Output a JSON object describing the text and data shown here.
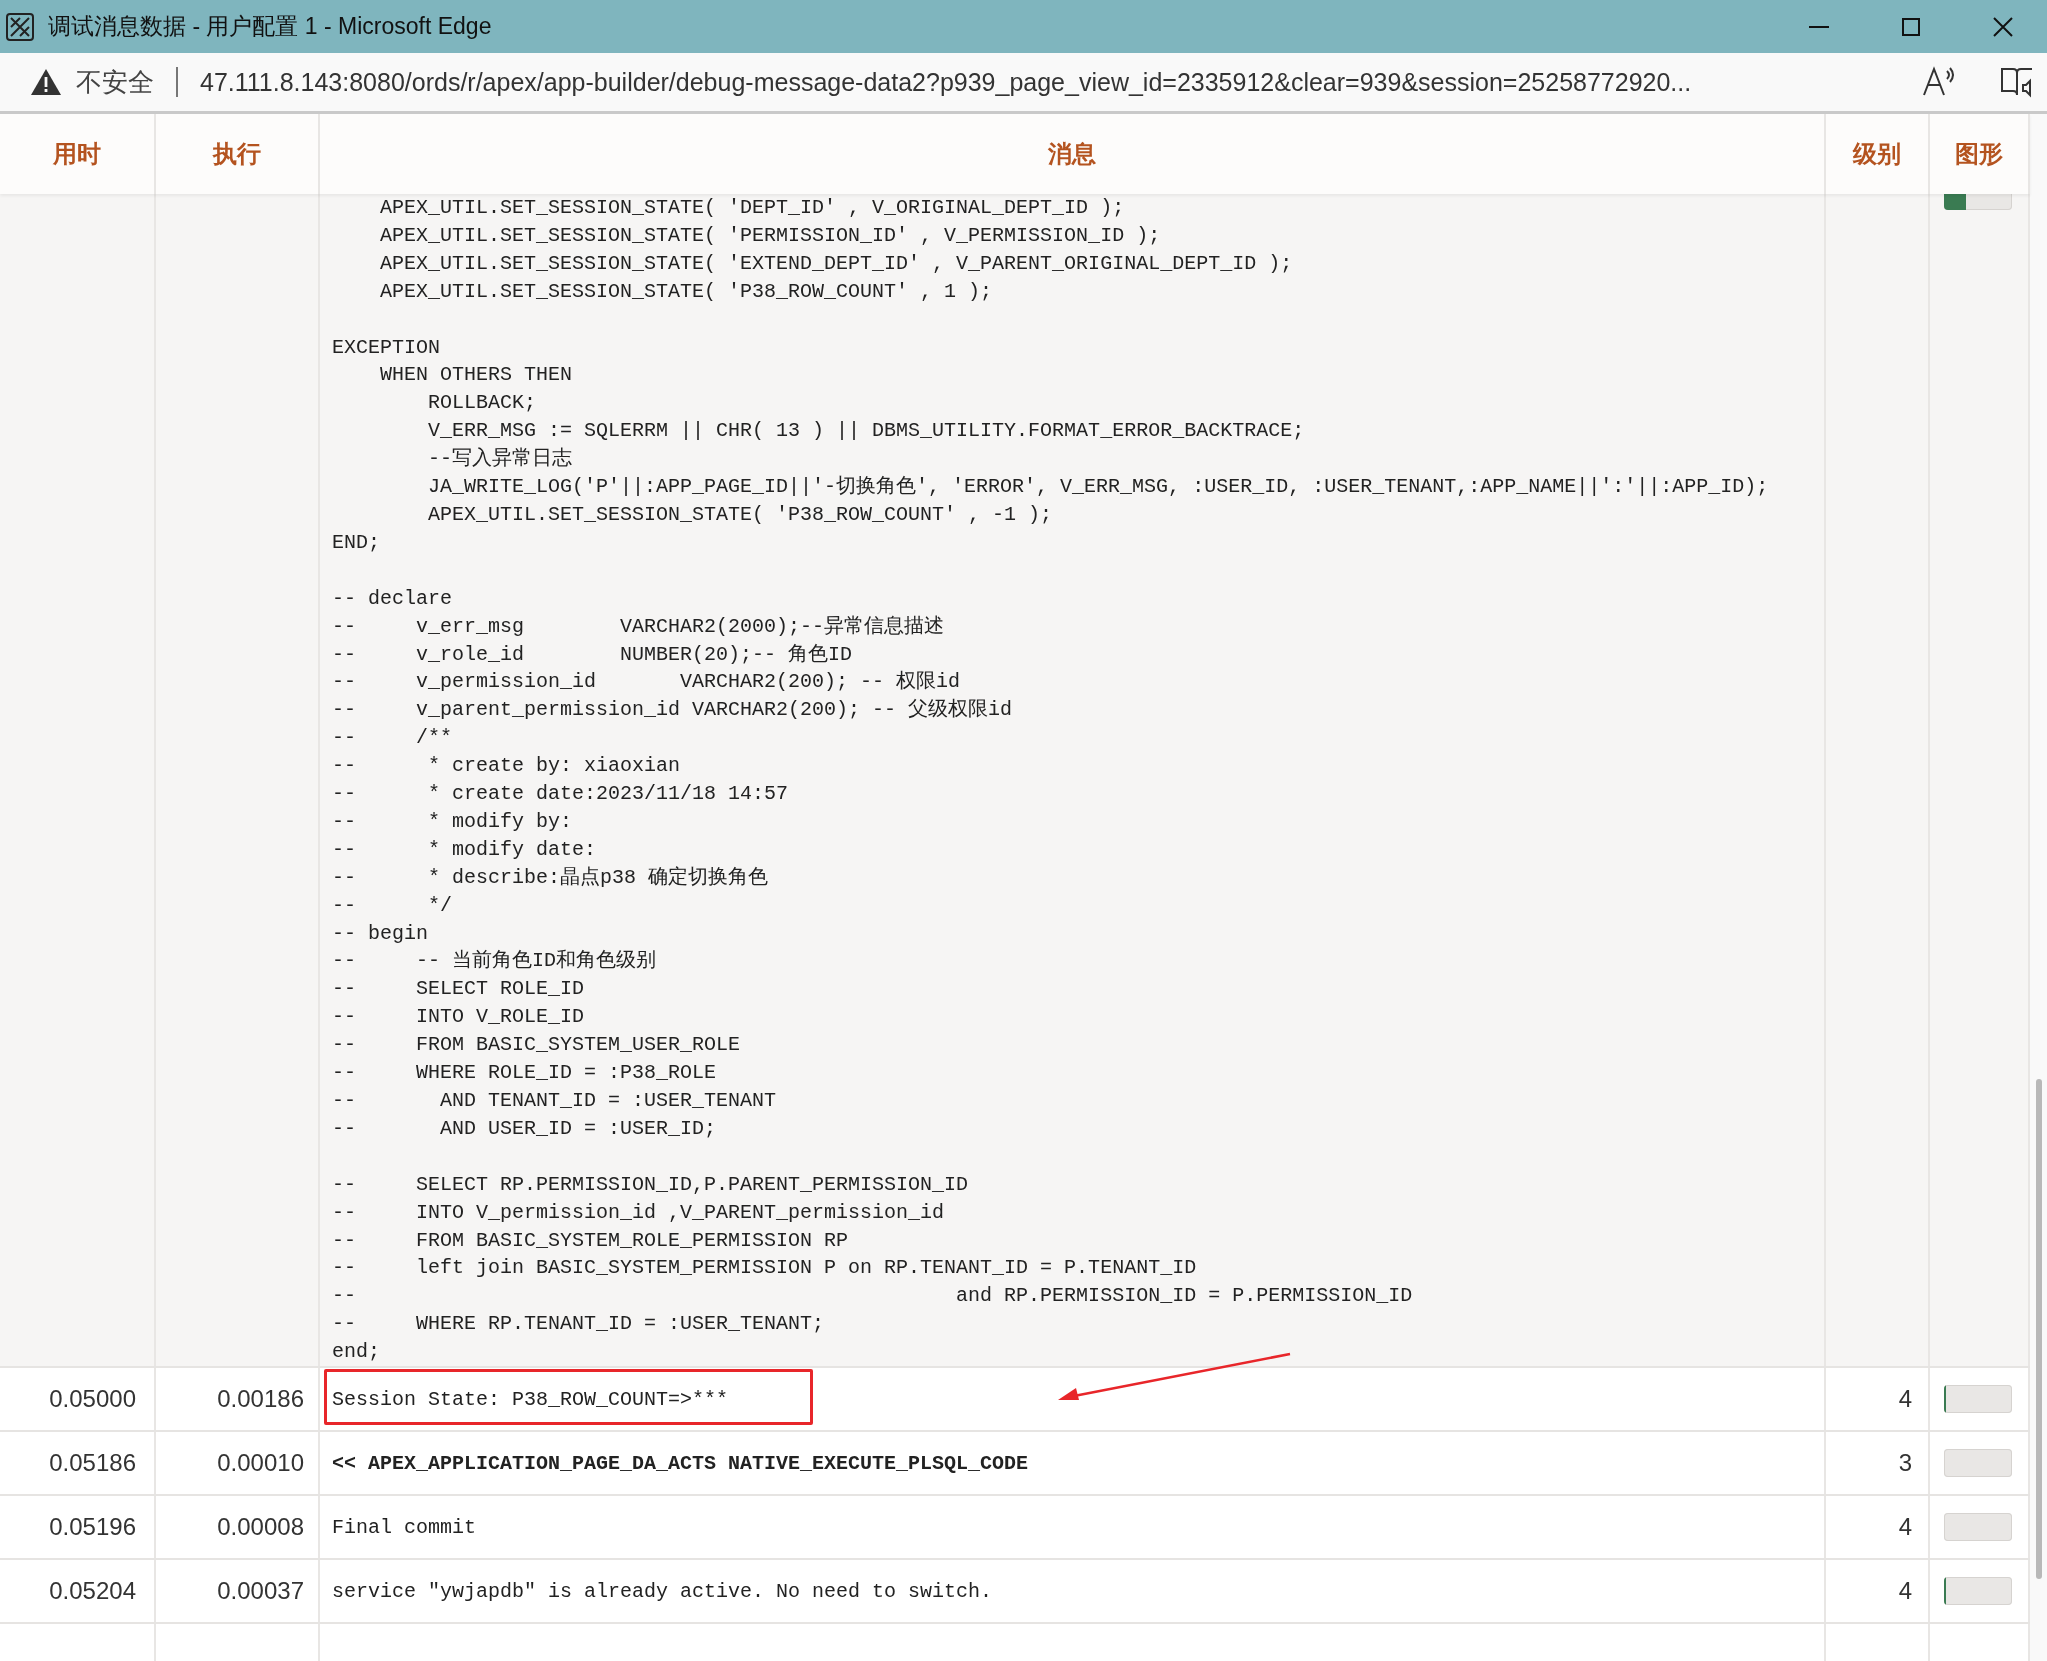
{
  "window": {
    "title": "调试消息数据 - 用户配置 1 - Microsoft Edge"
  },
  "address_bar": {
    "security": "不安全",
    "url": "47.111.8.143:8080/ords/r/apex/app-builder/debug-message-data2?p939_page_view_id=2335912&clear=939&session=25258772920..."
  },
  "table": {
    "columns": [
      "用时",
      "执行",
      "消息",
      "级别",
      "图形"
    ],
    "rows": [
      {
        "message": "    APEX_UTIL.SET_SESSION_STATE( 'DEPT_ID' , V_ORIGINAL_DEPT_ID );\n    APEX_UTIL.SET_SESSION_STATE( 'PERMISSION_ID' , V_PERMISSION_ID );\n    APEX_UTIL.SET_SESSION_STATE( 'EXTEND_DEPT_ID' , V_PARENT_ORIGINAL_DEPT_ID );\n    APEX_UTIL.SET_SESSION_STATE( 'P38_ROW_COUNT' , 1 );\n\nEXCEPTION\n    WHEN OTHERS THEN\n        ROLLBACK;\n        V_ERR_MSG := SQLERRM || CHR( 13 ) || DBMS_UTILITY.FORMAT_ERROR_BACKTRACE;\n        --写入异常日志\n        JA_WRITE_LOG('P'||:APP_PAGE_ID||'-切换角色', 'ERROR', V_ERR_MSG, :USER_ID, :USER_TENANT,:APP_NAME||':'||:APP_ID);\n        APEX_UTIL.SET_SESSION_STATE( 'P38_ROW_COUNT' , -1 );\nEND;\n\n-- declare\n--     v_err_msg        VARCHAR2(2000);--异常信息描述\n--     v_role_id        NUMBER(20);-- 角色ID\n--     v_permission_id       VARCHAR2(200); -- 权限id\n--     v_parent_permission_id VARCHAR2(200); -- 父级权限id\n--     /**\n--      * create by: xiaoxian\n--      * create date:2023/11/18 14:57\n--      * modify by:\n--      * modify date:\n--      * describe:晶点p38 确定切换角色\n--      */\n-- begin\n--     -- 当前角色ID和角色级别\n--     SELECT ROLE_ID\n--     INTO V_ROLE_ID\n--     FROM BASIC_SYSTEM_USER_ROLE\n--     WHERE ROLE_ID = :P38_ROLE\n--       AND TENANT_ID = :USER_TENANT\n--       AND USER_ID = :USER_ID;\n\n--     SELECT RP.PERMISSION_ID,P.PARENT_PERMISSION_ID\n--     INTO V_permission_id ,V_PARENT_permission_id\n--     FROM BASIC_SYSTEM_ROLE_PERMISSION RP\n--     left join BASIC_SYSTEM_PERMISSION P on RP.TENANT_ID = P.TENANT_ID\n--                                                  and RP.PERMISSION_ID = P.PERMISSION_ID\n--     WHERE RP.TENANT_ID = :USER_TENANT;\nend;",
        "level": 0.33,
        "highlighted": false,
        "bold": false
      },
      {
        "time": "0.05000",
        "exec": "0.00186",
        "message": "Session State: P38_ROW_COUNT=>***",
        "severity": "4",
        "level": 0.03,
        "highlighted": true,
        "bold": false
      },
      {
        "time": "0.05186",
        "exec": "0.00010",
        "message": "<< APEX_APPLICATION_PAGE_DA_ACTS NATIVE_EXECUTE_PLSQL_CODE",
        "severity": "3",
        "level": 0,
        "highlighted": false,
        "bold": true
      },
      {
        "time": "0.05196",
        "exec": "0.00008",
        "message": "Final commit",
        "severity": "4",
        "level": 0,
        "highlighted": false,
        "bold": false
      },
      {
        "time": "0.05204",
        "exec": "0.00037",
        "message": "service \"ywjapdb\" is already active. No need to switch.",
        "severity": "4",
        "level": 0.03,
        "highlighted": false,
        "bold": false
      }
    ]
  }
}
